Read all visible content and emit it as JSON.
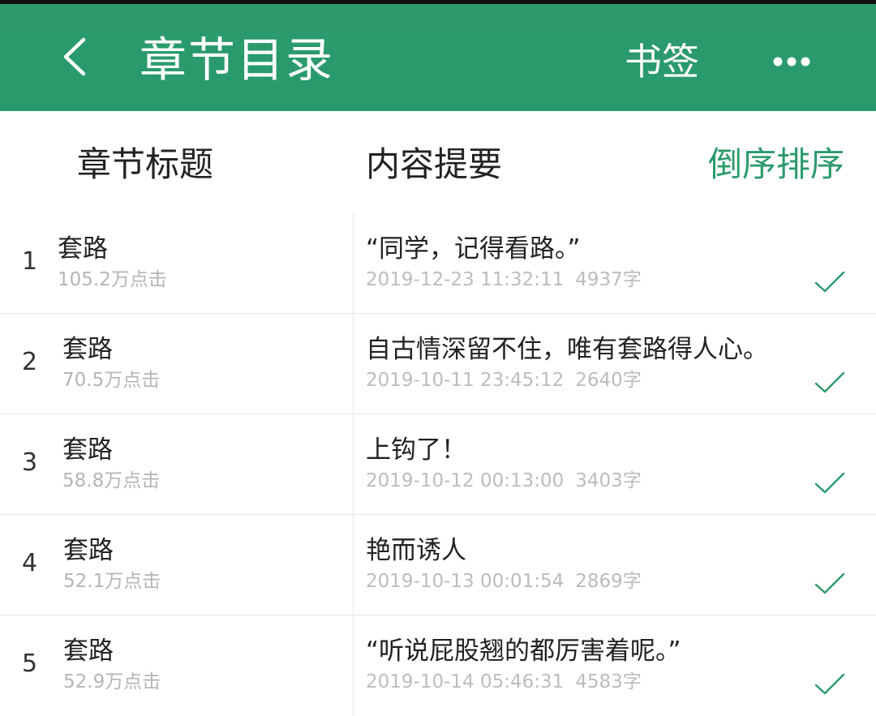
{
  "header": {
    "title": "章节目录",
    "bookmark_label": "书签",
    "back_icon": "chevron-left-icon",
    "more_icon": "more-dots-icon"
  },
  "columns": {
    "title": "章节标题",
    "summary": "内容提要",
    "sort": "倒序排序"
  },
  "colors": {
    "brand": "#2c9a6b",
    "check": "#2c9a6b"
  },
  "chapters": [
    {
      "num": "1",
      "title": "套路",
      "clicks": "105.2万点击",
      "summary": "“同学，记得看路。”",
      "date": "2019-12-23 11:32:11",
      "words": "4937字",
      "read": true
    },
    {
      "num": "2",
      "title": "套路",
      "clicks": "70.5万点击",
      "summary": "自古情深留不住，唯有套路得人心。",
      "date": "2019-10-11 23:45:12",
      "words": "2640字",
      "read": true
    },
    {
      "num": "3",
      "title": "套路",
      "clicks": "58.8万点击",
      "summary": "上钩了！",
      "date": "2019-10-12 00:13:00",
      "words": "3403字",
      "read": true
    },
    {
      "num": "4",
      "title": "套路",
      "clicks": "52.1万点击",
      "summary": "艳而诱人",
      "date": "2019-10-13 00:01:54",
      "words": "2869字",
      "read": true
    },
    {
      "num": "5",
      "title": "套路",
      "clicks": "52.9万点击",
      "summary": "“听说屁股翘的都厉害着呢。”",
      "date": "2019-10-14 05:46:31",
      "words": "4583字",
      "read": true
    }
  ]
}
